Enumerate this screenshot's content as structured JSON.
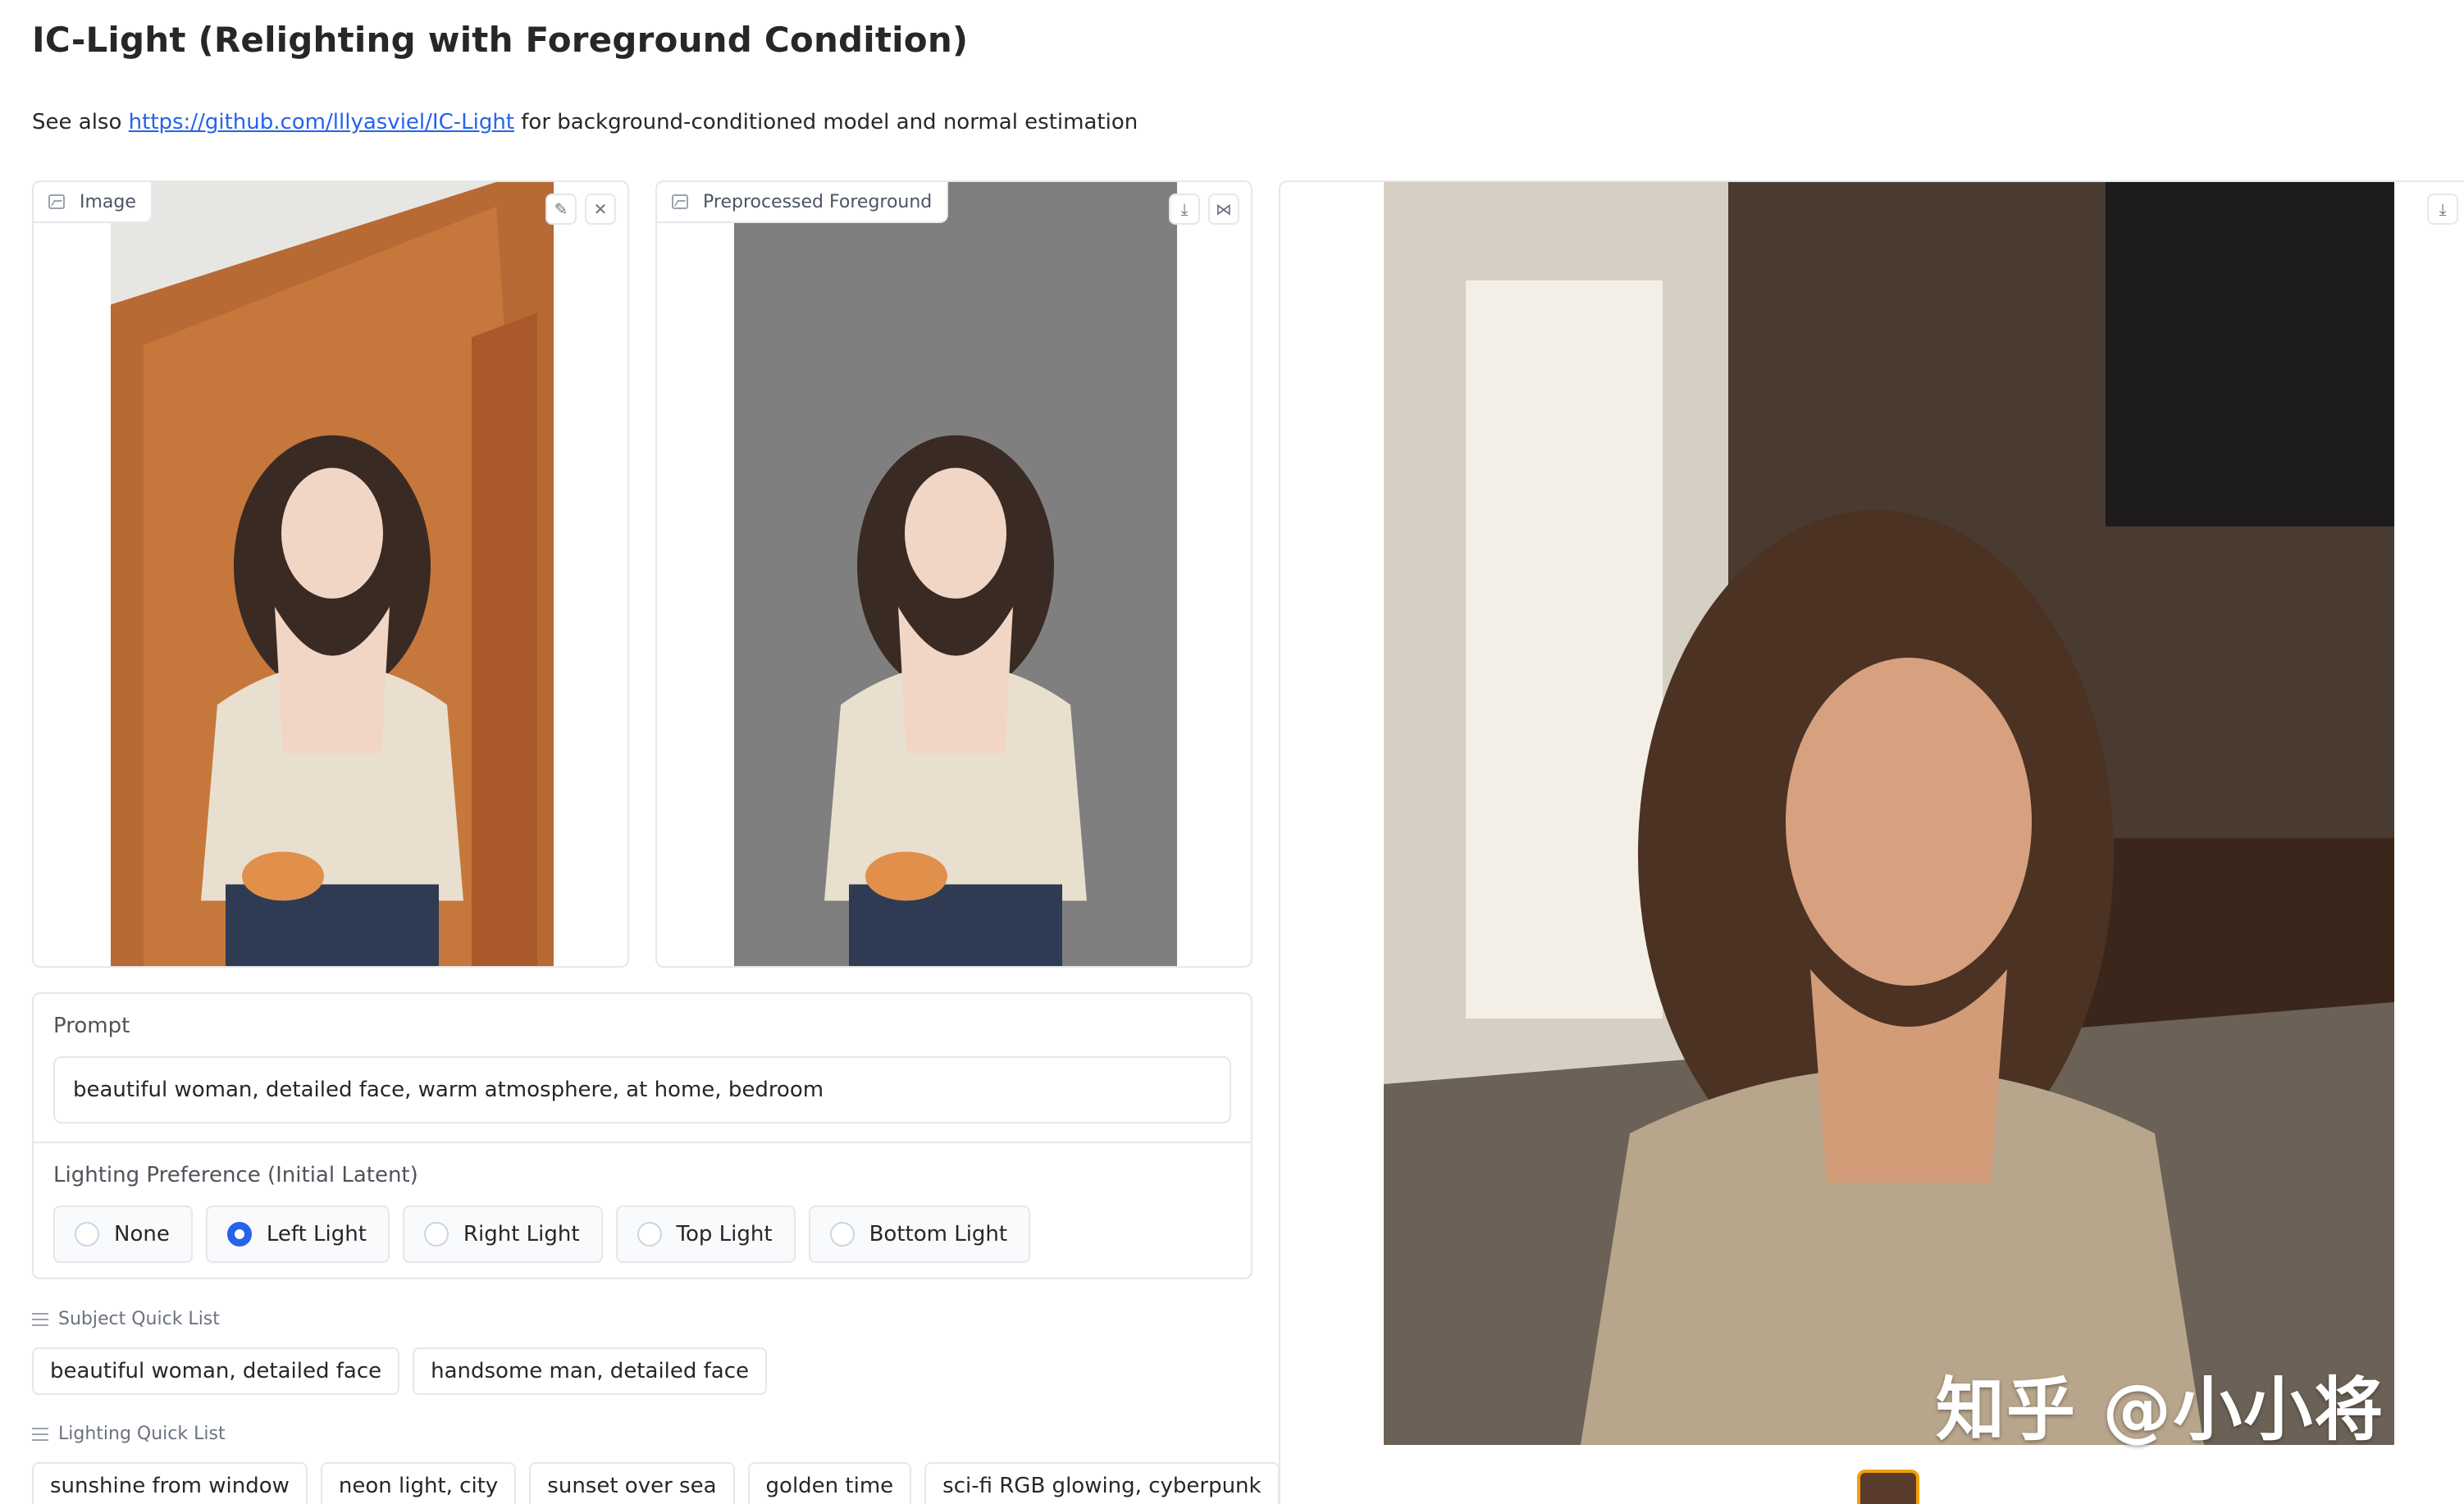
{
  "header": {
    "title": "IC-Light (Relighting with Foreground Condition)",
    "subtitle_prefix": "See also ",
    "subtitle_link": "https://github.com/lllyasviel/IC-Light",
    "subtitle_suffix": " for background-conditioned model and normal estimation"
  },
  "input_image": {
    "label": "Image",
    "icon": "image-icon",
    "tools": [
      "edit-icon",
      "close-icon"
    ]
  },
  "preprocessed_image": {
    "label": "Preprocessed Foreground",
    "icon": "image-icon",
    "tools": [
      "download-icon",
      "share-icon"
    ]
  },
  "output_gallery": {
    "tools": [
      "download-icon"
    ],
    "watermark": "知乎 @小小将"
  },
  "prompt": {
    "label": "Prompt",
    "value": "beautiful woman, detailed face, warm atmosphere, at home, bedroom"
  },
  "lighting": {
    "label": "Lighting Preference (Initial Latent)",
    "options": [
      "None",
      "Left Light",
      "Right Light",
      "Top Light",
      "Bottom Light"
    ],
    "selected": "Left Light"
  },
  "subject_quick_list": {
    "label": "Subject Quick List",
    "items": [
      "beautiful woman, detailed face",
      "handsome man, detailed face"
    ]
  },
  "lighting_quick_list": {
    "label": "Lighting Quick List",
    "items": [
      "sunshine from window",
      "neon light, city",
      "sunset over sea",
      "golden time",
      "sci-fi RGB glowing, cyberpunk"
    ]
  },
  "colors": {
    "accent": "#2563eb",
    "border": "#e5e7eb",
    "thumb_border": "#f59e0b"
  }
}
